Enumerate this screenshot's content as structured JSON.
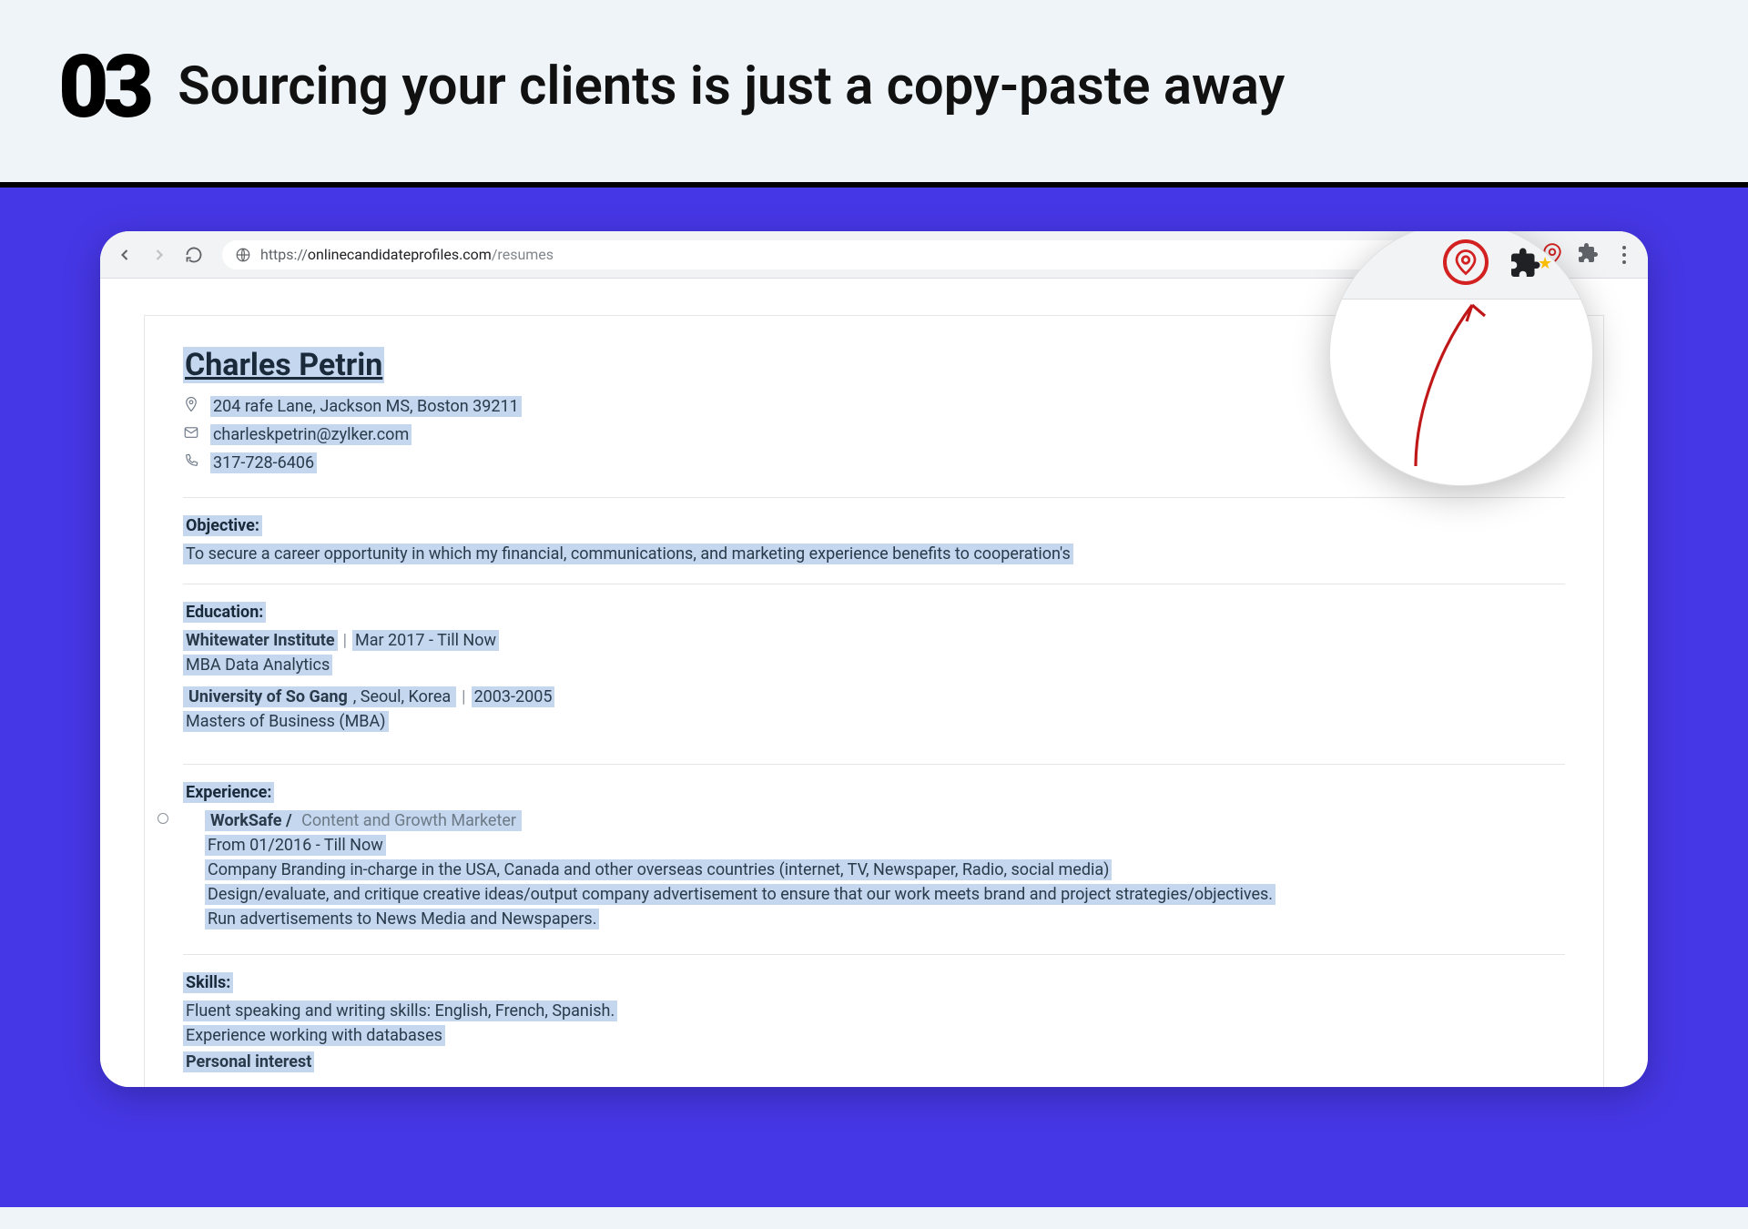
{
  "header": {
    "number": "03",
    "title": "Sourcing your clients is just a copy-paste away"
  },
  "url": {
    "protocol": "https://",
    "host": "onlinecandidateprofiles.com",
    "path": "/resumes"
  },
  "resume": {
    "name": "Charles Petrin",
    "address": "204 rafe Lane, Jackson MS, Boston 39211",
    "email": "charleskpetrin@zylker.com",
    "phone": "317-728-6406",
    "objective_title": "Objective:",
    "objective_text": "To secure a career opportunity in which my financial, communications, and marketing experience benefits to cooperation's",
    "education_title": "Education:",
    "education": [
      {
        "inst": "Whitewater Institute",
        "loc": "",
        "dates": "Mar 2017 - Till Now",
        "degree": "MBA Data Analytics"
      },
      {
        "inst": "University of So Gang",
        "loc": ", Seoul, Korea",
        "dates": "2003-2005",
        "degree": "Masters of Business (MBA)"
      }
    ],
    "experience_title": "Experience:",
    "experience": {
      "company": "WorkSafe /",
      "role": " Content and Growth Marketer",
      "period": "From 01/2016 - Till Now",
      "bullets": [
        "Company Branding in-charge in the USA, Canada and other overseas countries (internet, TV, Newspaper, Radio, social media)",
        "Design/evaluate, and critique creative ideas/output company advertisement to ensure that our work meets brand and project strategies/objectives.",
        "Run advertisements to News Media and Newspapers."
      ]
    },
    "skills_title": "Skills:",
    "skills": [
      "Fluent speaking and writing skills: English, French, Spanish.",
      "Experience working with databases"
    ],
    "personal_interest_title": "Personal interest"
  }
}
